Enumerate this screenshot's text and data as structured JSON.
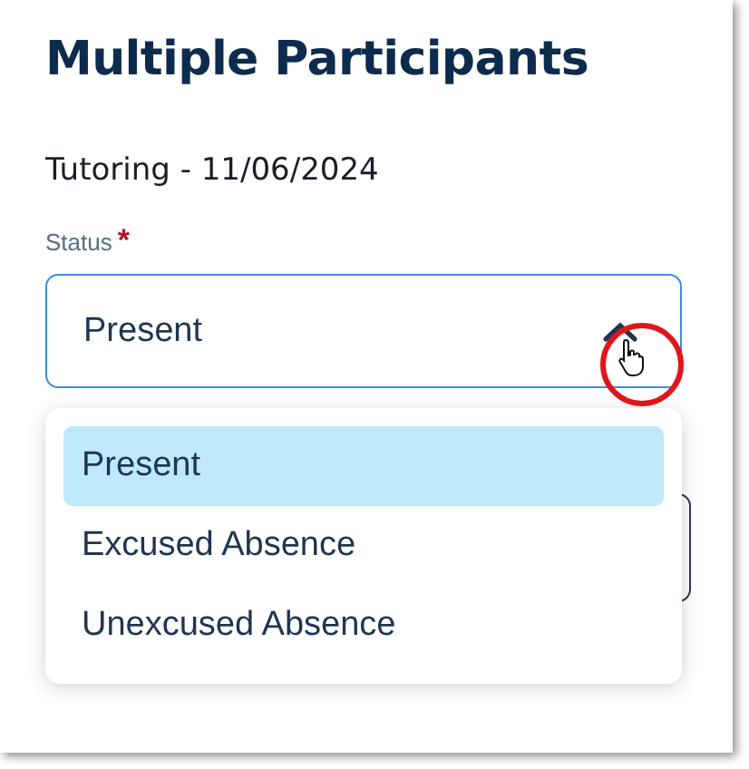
{
  "title": "Multiple Participants",
  "subtitle": "Tutoring - 11/06/2024",
  "status": {
    "label": "Status",
    "required_mark": "*",
    "value": "Present",
    "expanded": true,
    "options": [
      {
        "label": "Present",
        "selected": true
      },
      {
        "label": "Excused Absence",
        "selected": false
      },
      {
        "label": "Unexcused Absence",
        "selected": false
      }
    ]
  }
}
